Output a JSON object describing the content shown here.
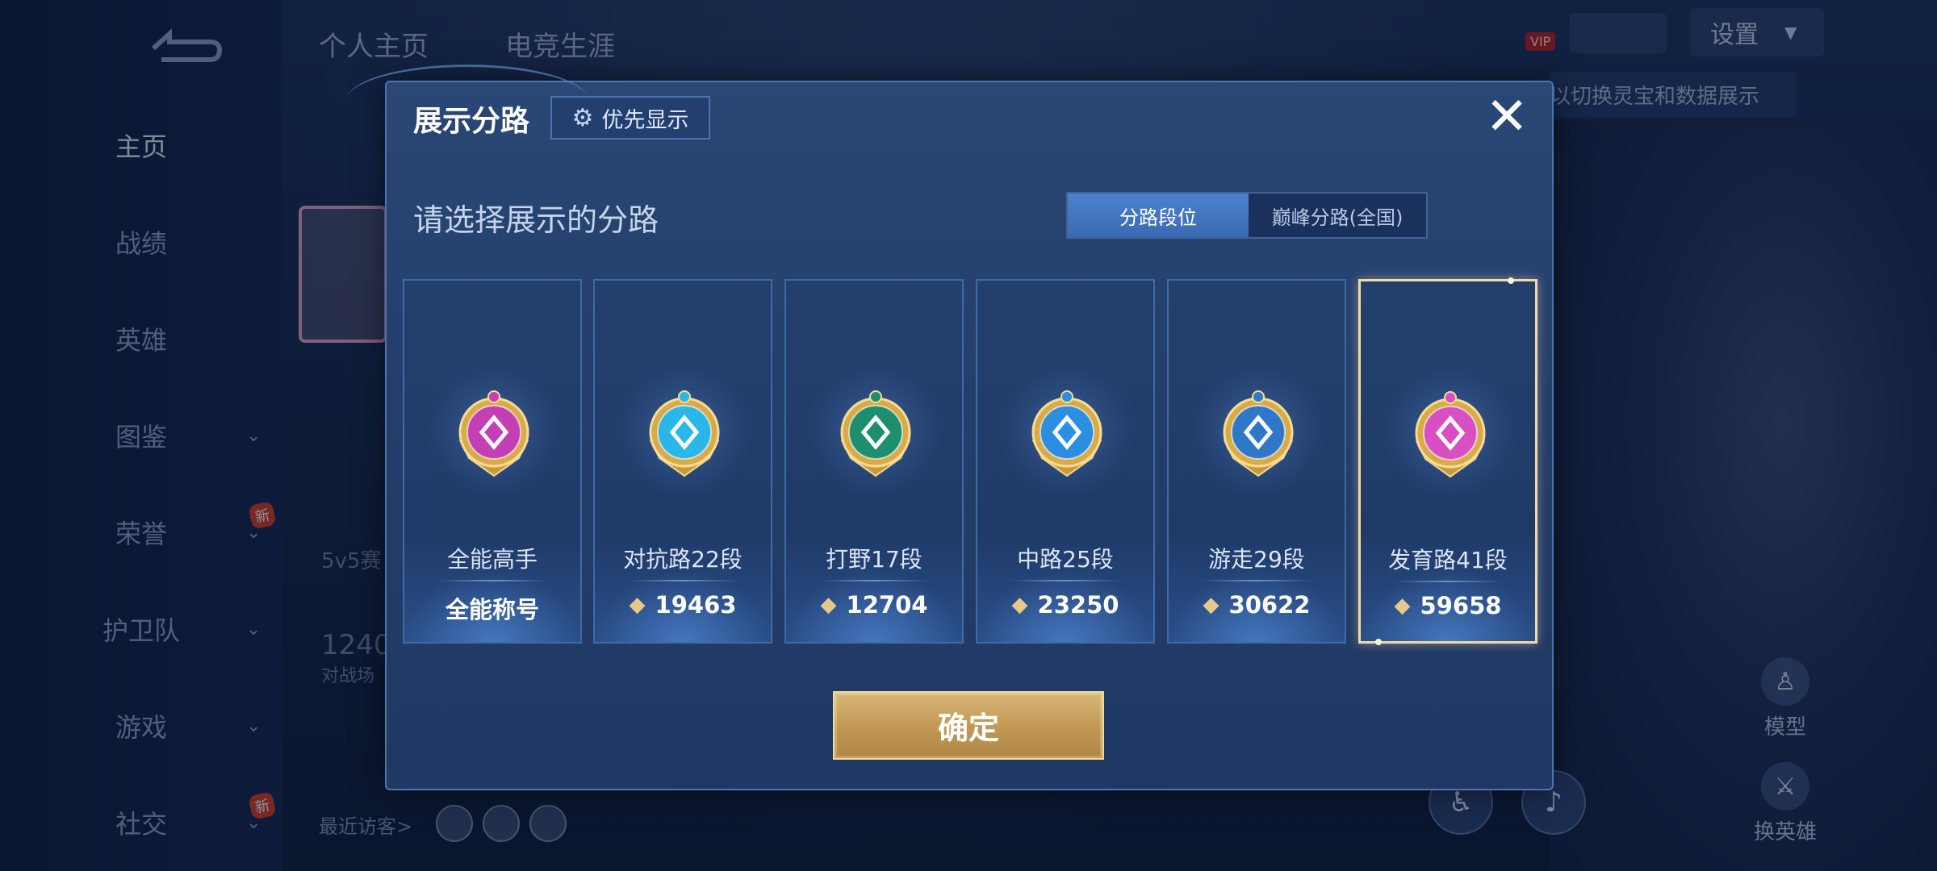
{
  "background": {
    "nav": {
      "items": [
        {
          "label": "主页",
          "active": true,
          "chevron": false,
          "is_new": false
        },
        {
          "label": "战绩",
          "active": false,
          "chevron": false,
          "is_new": false
        },
        {
          "label": "英雄",
          "active": false,
          "chevron": false,
          "is_new": false
        },
        {
          "label": "图鉴",
          "active": false,
          "chevron": true,
          "is_new": false
        },
        {
          "label": "荣誉",
          "active": false,
          "chevron": true,
          "is_new": true
        },
        {
          "label": "护卫队",
          "active": false,
          "chevron": true,
          "is_new": false
        },
        {
          "label": "游戏",
          "active": false,
          "chevron": true,
          "is_new": false
        },
        {
          "label": "社交",
          "active": false,
          "chevron": true,
          "is_new": true
        }
      ],
      "new_badge": "新"
    },
    "top_tabs": [
      "个人主页",
      "电竞生涯"
    ],
    "vip_label": "VIP",
    "settings_label": "设置",
    "hint_text": "以切换灵宝和数据展示",
    "bg_texts": [
      "5v5赛",
      "1240",
      "对战场"
    ],
    "visitors_label": "最近访客>",
    "side_actions": [
      {
        "label": "模型",
        "icon": "person-model-icon"
      },
      {
        "label": "换英雄",
        "icon": "swap-hero-icon"
      }
    ]
  },
  "modal": {
    "title": "展示分路",
    "priority_button": "优先显示",
    "close_glyph": "✕",
    "subtitle": "请选择展示的分路",
    "toggle": {
      "options": [
        "分路段位",
        "巅峰分路(全国)"
      ],
      "selected": "分路段位"
    },
    "lanes": [
      {
        "label": "全能高手",
        "value": "全能称号",
        "show_points_icon": false,
        "medal_color": "#c53fb4",
        "selected": false
      },
      {
        "label": "对抗路22段",
        "value": "19463",
        "show_points_icon": true,
        "medal_color": "#29b6e8",
        "selected": false
      },
      {
        "label": "打野17段",
        "value": "12704",
        "show_points_icon": true,
        "medal_color": "#1e8f6e",
        "selected": false
      },
      {
        "label": "中路25段",
        "value": "23250",
        "show_points_icon": true,
        "medal_color": "#2b8ee0",
        "selected": false
      },
      {
        "label": "游走29段",
        "value": "30622",
        "show_points_icon": true,
        "medal_color": "#2f77c9",
        "selected": false
      },
      {
        "label": "发育路41段",
        "value": "59658",
        "show_points_icon": true,
        "medal_color": "#d84fc4",
        "selected": true
      }
    ],
    "confirm_label": "确定"
  },
  "colors": {
    "accent_blue": "#3a6ab2",
    "gold": "#c29a55",
    "selected_border": "#f3d9a4"
  }
}
